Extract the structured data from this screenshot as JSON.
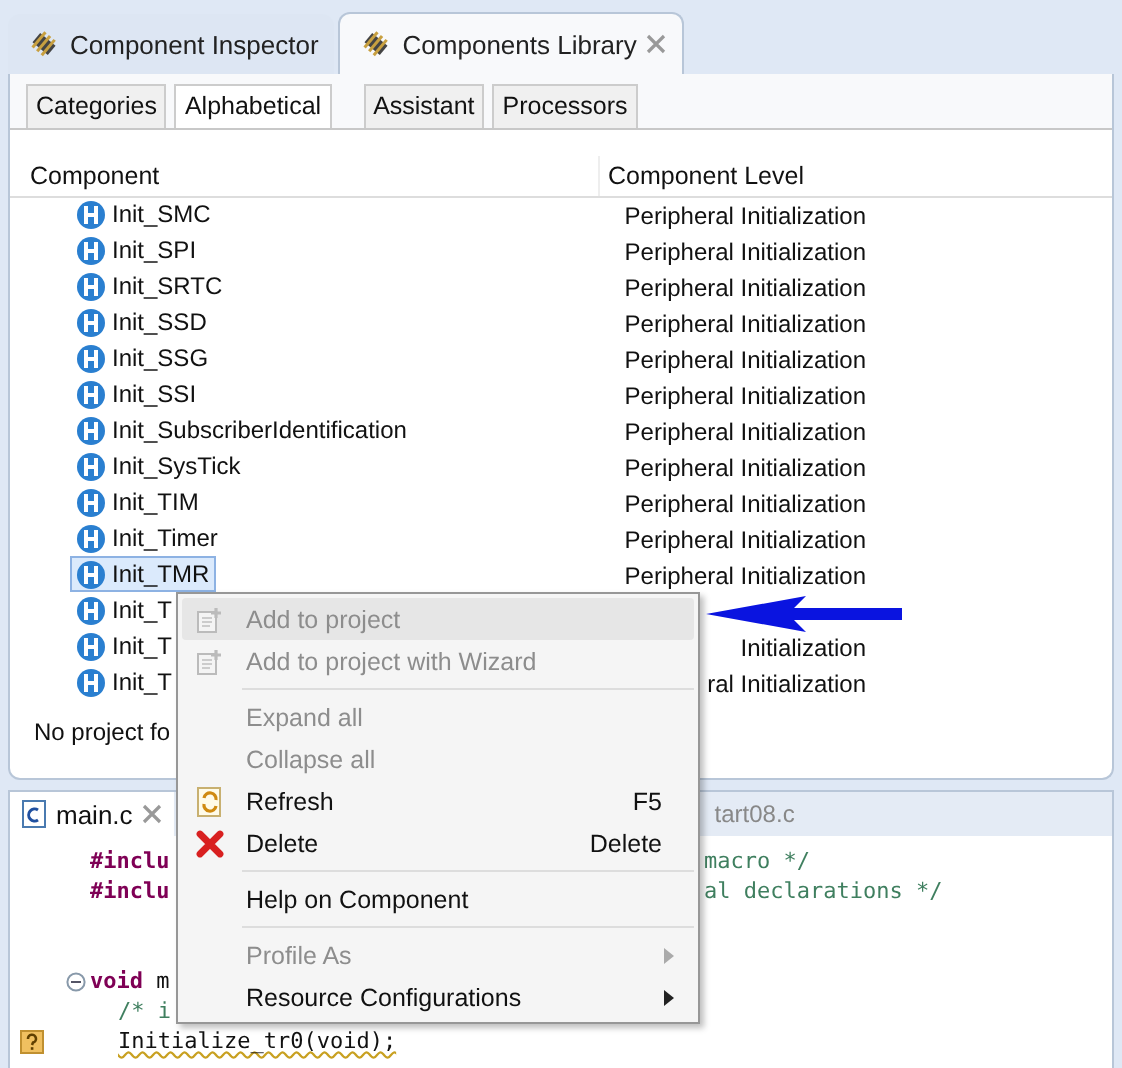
{
  "top_tabs": [
    {
      "label": "Component Inspector",
      "selected": false,
      "closable": false
    },
    {
      "label": "Components Library",
      "selected": true,
      "closable": true
    }
  ],
  "sub_tabs": [
    {
      "label": "Categories",
      "selected": false
    },
    {
      "label": "Alphabetical",
      "selected": true
    },
    {
      "label": "Assistant",
      "selected": false
    },
    {
      "label": "Processors",
      "selected": false
    }
  ],
  "table": {
    "columns": [
      "Component",
      "Component Level"
    ],
    "rows": [
      {
        "name": "Init_SMC",
        "level": "Peripheral Initialization",
        "selected": false
      },
      {
        "name": "Init_SPI",
        "level": "Peripheral Initialization",
        "selected": false
      },
      {
        "name": "Init_SRTC",
        "level": "Peripheral Initialization",
        "selected": false
      },
      {
        "name": "Init_SSD",
        "level": "Peripheral Initialization",
        "selected": false
      },
      {
        "name": "Init_SSG",
        "level": "Peripheral Initialization",
        "selected": false
      },
      {
        "name": "Init_SSI",
        "level": "Peripheral Initialization",
        "selected": false
      },
      {
        "name": "Init_SubscriberIdentification",
        "level": "Peripheral Initialization",
        "selected": false
      },
      {
        "name": "Init_SysTick",
        "level": "Peripheral Initialization",
        "selected": false
      },
      {
        "name": "Init_TIM",
        "level": "Peripheral Initialization",
        "selected": false
      },
      {
        "name": "Init_Timer",
        "level": "Peripheral Initialization",
        "selected": false
      },
      {
        "name": "Init_TMR",
        "level": "Peripheral Initialization",
        "selected": true
      },
      {
        "name": "Init_T",
        "selected": false
      },
      {
        "name": "Init_T",
        "level": "Initialization",
        "selected": false
      },
      {
        "name": "Init_T",
        "level": "ral Initialization",
        "selected": false
      }
    ]
  },
  "status": "No project fo",
  "editor": {
    "tabs": [
      {
        "label": "main.c",
        "selected": true,
        "closable": true
      },
      {
        "label": "tart08.c",
        "selected": false,
        "closable": false
      }
    ],
    "lines": [
      {
        "kind": "code",
        "left": [
          {
            "text": "#inclu",
            "kind": "directive"
          }
        ],
        "right": [
          {
            "text": "macro */",
            "kind": "comment"
          }
        ]
      },
      {
        "kind": "code",
        "left": [
          {
            "text": "#inclu",
            "kind": "directive"
          }
        ],
        "right": [
          {
            "text": "al declarations */",
            "kind": "comment"
          }
        ]
      },
      {
        "kind": "blank"
      },
      {
        "kind": "blank"
      },
      {
        "kind": "code",
        "fold": true,
        "left": [
          {
            "text": "void",
            "kind": "keyword"
          },
          {
            "text": " m",
            "kind": "plain"
          }
        ]
      },
      {
        "kind": "code",
        "indent": true,
        "left": [
          {
            "text": "/* i",
            "kind": "comment"
          }
        ]
      },
      {
        "kind": "code",
        "indent": true,
        "warning": true,
        "left": [
          {
            "text": "Initialize_tr0(void);",
            "kind": "error"
          }
        ]
      }
    ]
  },
  "context_menu": {
    "items": [
      {
        "kind": "add",
        "label": "Add to project",
        "disabled": true,
        "highlighted": true
      },
      {
        "kind": "add",
        "label": "Add to project with Wizard",
        "disabled": true,
        "highlighted": false
      },
      {
        "kind": "separator"
      },
      {
        "kind": "plain",
        "label": "Expand all",
        "disabled": true,
        "highlighted": false
      },
      {
        "kind": "plain",
        "label": "Collapse all",
        "disabled": true,
        "highlighted": false
      },
      {
        "kind": "refresh",
        "label": "Refresh",
        "shortcut": "F5",
        "disabled": false,
        "highlighted": false
      },
      {
        "kind": "delete",
        "label": "Delete",
        "shortcut": "Delete",
        "disabled": false,
        "highlighted": false
      },
      {
        "kind": "separator"
      },
      {
        "kind": "plain",
        "label": "Help on Component",
        "disabled": false,
        "highlighted": false
      },
      {
        "kind": "separator"
      },
      {
        "kind": "submenu",
        "label": "Profile As",
        "disabled": true,
        "highlighted": false
      },
      {
        "kind": "submenu",
        "label": "Resource Configurations",
        "disabled": false,
        "highlighted": false
      }
    ]
  }
}
